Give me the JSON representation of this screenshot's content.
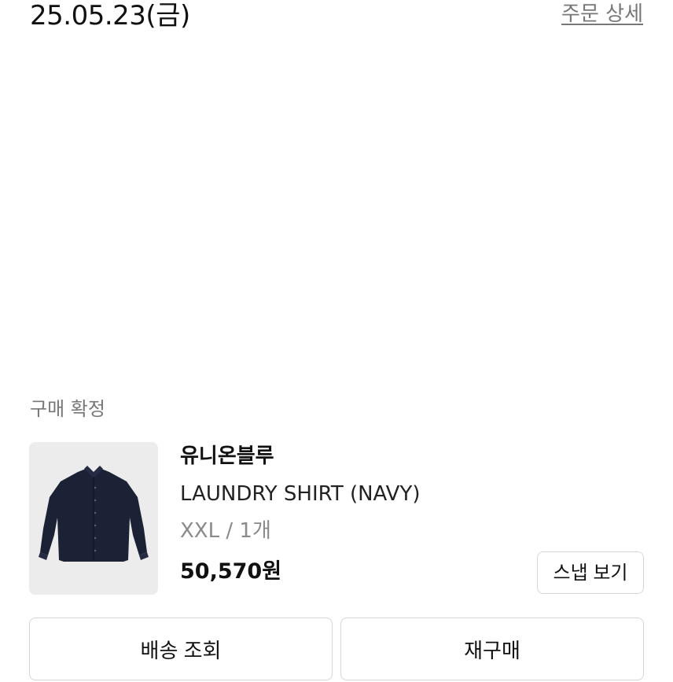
{
  "order": {
    "date": "25.05.23(금)",
    "detail_link": "주문 상세"
  },
  "status": {
    "label": "구매 확정"
  },
  "product": {
    "brand": "유니온블루",
    "name": "LAUNDRY SHIRT (NAVY)",
    "option": "XXL / 1개",
    "price": "50,570원",
    "image_icon": "navy-shirt-icon"
  },
  "buttons": {
    "snap": "스냅 보기",
    "track_delivery": "배송 조회",
    "reorder": "재구매"
  },
  "colors": {
    "shirt": "#1c2236",
    "thumbnail_bg": "#ececec",
    "border": "#d6d6d6",
    "muted_text": "#777777"
  }
}
